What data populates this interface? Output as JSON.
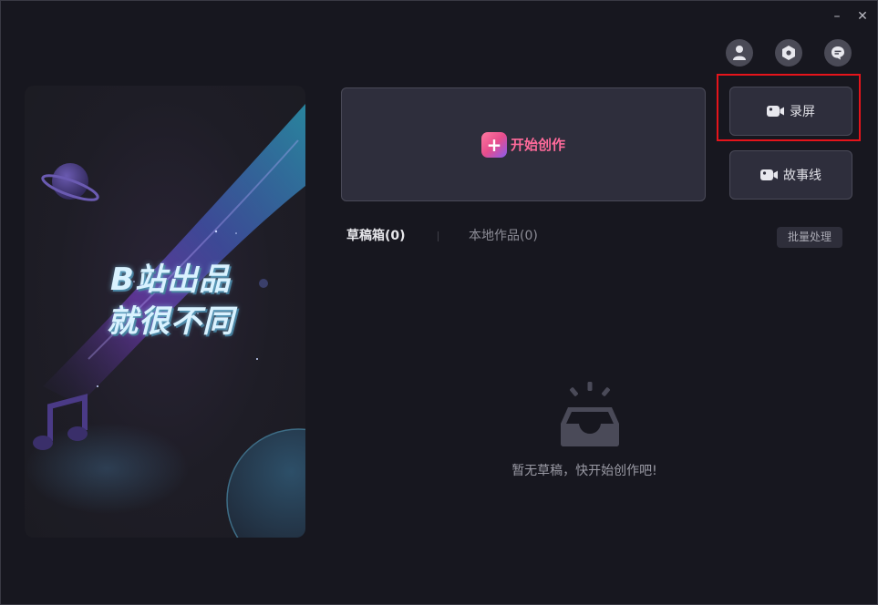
{
  "window": {
    "minimize_glyph": "–",
    "close_glyph": "✕"
  },
  "top_icons": [
    "user-icon",
    "settings-icon",
    "feedback-icon"
  ],
  "banner": {
    "line1": "B站出品",
    "line2": "就很不同"
  },
  "start_card": {
    "label": "开始创作",
    "plus": "+"
  },
  "actions": {
    "record_label": "录屏",
    "story_label": "故事线"
  },
  "tabs": [
    {
      "label": "草稿箱(0)",
      "active": true
    },
    {
      "label": "本地作品(0)",
      "active": false
    }
  ],
  "batch_label": "批量处理",
  "empty_state": {
    "message": "暂无草稿，快开始创作吧!"
  },
  "colors": {
    "accent_pink": "#ff6a9a",
    "highlight_red": "#e5141b",
    "background": "#17171f"
  }
}
